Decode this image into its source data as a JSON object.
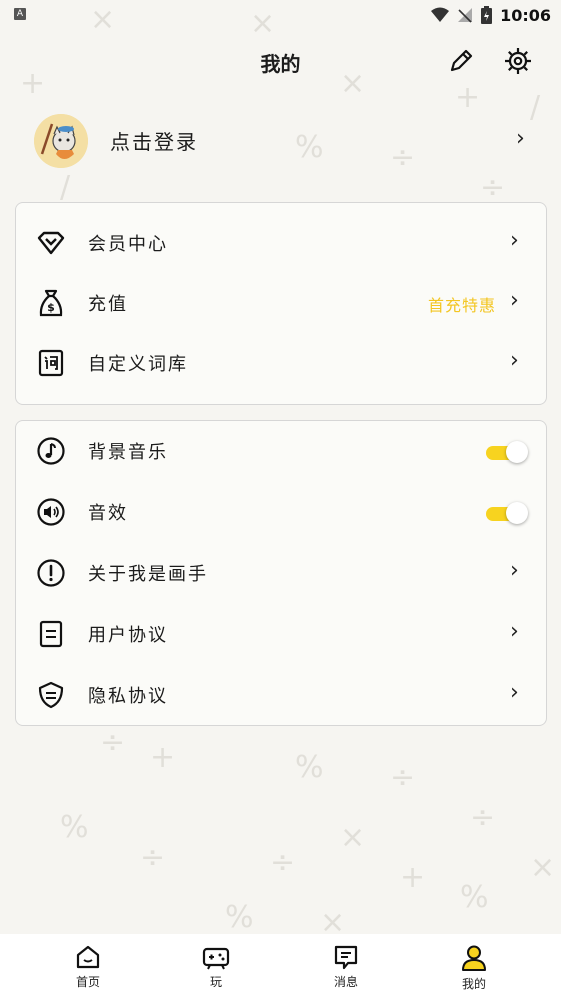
{
  "status_bar": {
    "notif_letter": "A",
    "time": "10:06"
  },
  "header": {
    "title": "我的",
    "edit_icon": "pencil-icon",
    "settings_icon": "gear-icon"
  },
  "profile": {
    "login_text": "点击登录",
    "avatar_icon": "cat-painter-avatar",
    "chevron": "›"
  },
  "card1": [
    {
      "icon": "diamond-vip-icon",
      "label": "会员中心",
      "chevron": "›"
    },
    {
      "icon": "money-bag-icon",
      "label": "充值",
      "promo": "首充特惠",
      "chevron": "›"
    },
    {
      "icon": "word-book-icon",
      "label": "自定义词库",
      "chevron": "›"
    }
  ],
  "card2": [
    {
      "icon": "music-note-icon",
      "label": "背景音乐",
      "toggle": true
    },
    {
      "icon": "speaker-icon",
      "label": "音效",
      "toggle": true
    },
    {
      "icon": "exclamation-icon",
      "label": "关于我是画手",
      "chevron": "›"
    },
    {
      "icon": "document-icon",
      "label": "用户协议",
      "chevron": "›"
    },
    {
      "icon": "shield-icon",
      "label": "隐私协议",
      "chevron": "›"
    }
  ],
  "bottom_nav": [
    {
      "icon": "home-icon",
      "label": "首页"
    },
    {
      "icon": "gamepad-icon",
      "label": "玩"
    },
    {
      "icon": "message-icon",
      "label": "消息"
    },
    {
      "icon": "user-icon",
      "label": "我的",
      "active": true
    }
  ],
  "colors": {
    "accent": "#f7d31f",
    "promo": "#f3c623",
    "background": "#f6f5f1"
  }
}
